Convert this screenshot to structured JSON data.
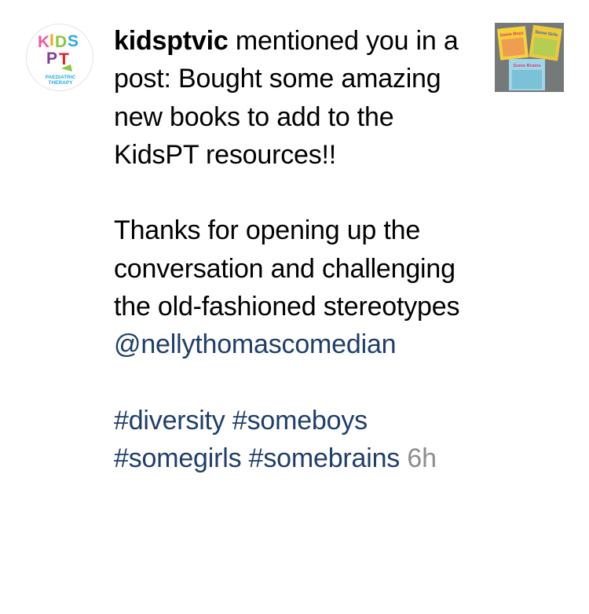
{
  "notification": {
    "username": "kidsptvic",
    "action_text": " mentioned you in a post: ",
    "caption_line1": "Bought some amazing new books to add to the KidsPT resources!!",
    "caption_line2": "Thanks for opening up the conversation and challenging the old-fashioned stereotypes",
    "mention": "@nellythomascomedian",
    "hashtags": [
      "#diversity",
      "#someboys",
      "#somegirls",
      "#somebrains"
    ],
    "timestamp": "6h"
  },
  "avatar": {
    "logo_letters": [
      "K",
      "I",
      "D",
      "S",
      "P",
      "T"
    ],
    "logo_caption_line1": "PAEDIATRIC",
    "logo_caption_line2": "THERAPY"
  },
  "thumbnail": {
    "book1_title": "Some Boys",
    "book2_title": "Some Girls",
    "book3_title": "Some Brains"
  },
  "colors": {
    "mention": "#1f3e6b",
    "timestamp": "#8e8e8e",
    "text": "#000000"
  }
}
